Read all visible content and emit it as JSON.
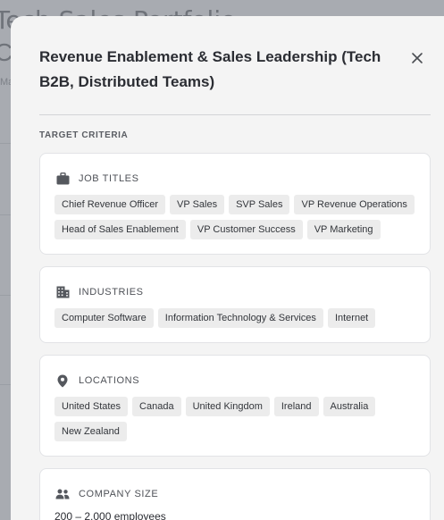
{
  "background": {
    "title_line1": "Tech Sales Portfolio",
    "title_line2": "C",
    "subtitle": "Ma"
  },
  "modal": {
    "title": "Revenue Enablement & Sales Leadership (Tech B2B, Distributed Teams)",
    "close_icon": "close-icon",
    "section_label": "TARGET CRITERIA",
    "job_titles": {
      "label": "JOB TITLES",
      "icon": "briefcase-icon",
      "items": [
        "Chief Revenue Officer",
        "VP Sales",
        "SVP Sales",
        "VP Revenue Operations",
        "Head of Sales Enablement",
        "VP Customer Success",
        "VP Marketing"
      ]
    },
    "industries": {
      "label": "INDUSTRIES",
      "icon": "building-icon",
      "items": [
        "Computer Software",
        "Information Technology & Services",
        "Internet"
      ]
    },
    "locations": {
      "label": "LOCATIONS",
      "icon": "location-pin-icon",
      "items": [
        "United States",
        "Canada",
        "United Kingdom",
        "Ireland",
        "Australia",
        "New Zealand"
      ]
    },
    "company_size": {
      "label": "COMPANY SIZE",
      "icon": "people-icon",
      "value": "200 – 2,000 employees"
    }
  }
}
